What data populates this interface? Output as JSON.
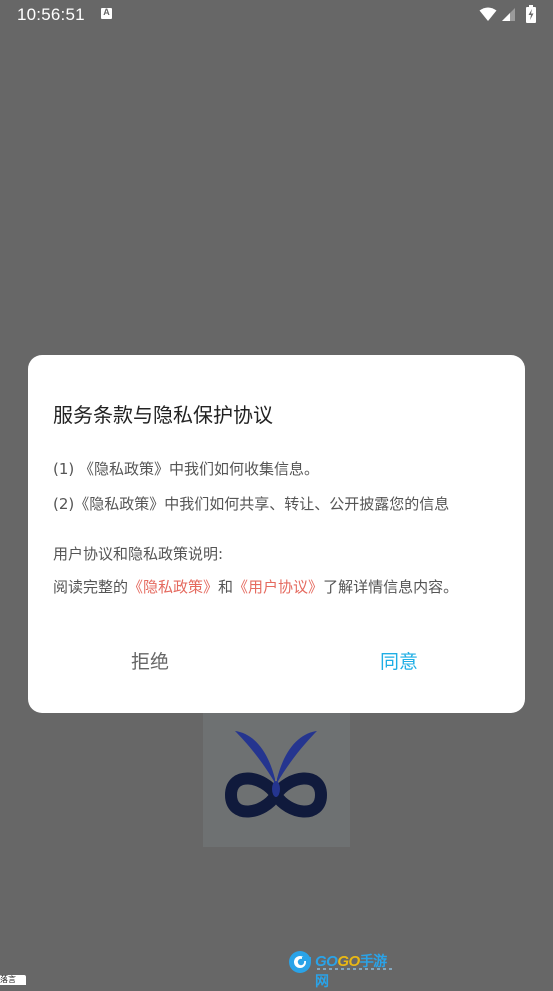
{
  "status_bar": {
    "time": "10:56:51",
    "notification_icon_letter": "A",
    "icons": [
      "a-notification-icon",
      "wifi-icon",
      "cell-signal-icon",
      "battery-charging-icon"
    ]
  },
  "dialog": {
    "title": "服务条款与隐私保护协议",
    "line1": "(1) 《隐私政策》中我们如何收集信息。",
    "line2": "(2)《隐私政策》中我们如何共享、转让、公开披露您的信息",
    "explain_label": "用户协议和隐私政策说明:",
    "read_prefix": "阅读完整的",
    "privacy_link": "《隐私政策》",
    "and_text": "和",
    "user_agreement_link": "《用户协议》",
    "read_suffix": "了解详情信息内容。",
    "refuse_button": "拒绝",
    "agree_button": "同意"
  },
  "splash": {
    "brand_go1": "GO",
    "brand_go2": "GO",
    "brand_cn": "手游网",
    "corner_badge": "落言"
  },
  "colors": {
    "scrim_background": "#676767",
    "link": "#e56a5f",
    "agree": "#1eaee5",
    "logo_navy": "#101a3c",
    "logo_blue": "#25358f"
  }
}
